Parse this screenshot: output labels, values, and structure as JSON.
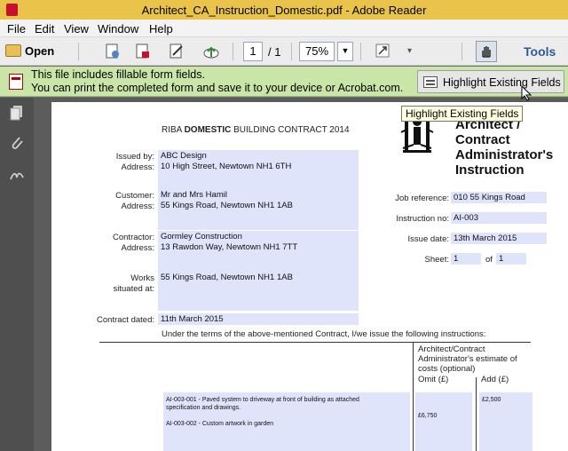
{
  "window": {
    "title": "Architect_CA_Instruction_Domestic.pdf - Adobe Reader"
  },
  "menu": [
    "File",
    "Edit",
    "View",
    "Window",
    "Help"
  ],
  "toolbar": {
    "open_label": "Open",
    "page_current": "1",
    "page_total": "/ 1",
    "zoom": "75%",
    "tools_label": "Tools"
  },
  "form_notice": {
    "line1": "This file includes fillable form fields.",
    "line2": "You can print the completed form and save it to your device or Acrobat.com.",
    "button": "Highlight Existing Fields",
    "tooltip": "Highlight Existing Fields"
  },
  "document": {
    "header_prefix": "RIBA ",
    "header_bold": "DOMESTIC",
    "header_suffix": " BUILDING CONTRACT 2014",
    "title_lines": [
      "Architect /",
      "Contract",
      "Administrator's",
      "Instruction"
    ],
    "labels": {
      "issued_by": "Issued by:",
      "issued_address": "Address:",
      "customer": "Customer:",
      "customer_address": "Address:",
      "contractor": "Contractor:",
      "contractor_address": "Address:",
      "works_1": "Works",
      "works_2": "situated at:",
      "contract_dated": "Contract dated:",
      "job_reference": "Job reference:",
      "instruction_no": "Instruction no:",
      "issue_date": "Issue date:",
      "sheet": "Sheet:",
      "of": "of"
    },
    "values": {
      "issued_by": "ABC Design",
      "issued_address": "10 High Street, Newtown NH1 6TH",
      "customer": "Mr and Mrs Hamil",
      "customer_address": "55 Kings Road, Newtown NH1 1AB",
      "contractor": "Gormley Construction",
      "contractor_address": "13 Rawdon Way, Newtown NH1 7TT",
      "works": "55 Kings Road, Newtown NH1 1AB",
      "contract_dated": "11th March 2015",
      "job_reference": "010 55 Kings Road",
      "instruction_no": "AI-003",
      "issue_date": "13th March 2015",
      "sheet": "1",
      "sheet_of": "1"
    },
    "instructions_intro": "Under the terms of the above-mentioned Contract, I/we issue the following instructions:",
    "estimate_header": [
      "Architect/Contract",
      "Administrator's estimate of",
      "costs (optional)"
    ],
    "omit_label": "Omit (£)",
    "add_label": "Add (£)",
    "instructions": [
      {
        "line1": "AI-003-001 - Paved system to driveway at front of building as attached",
        "line2": "specification and drawings.",
        "omit": "",
        "add": "£2,500"
      },
      {
        "line1": "AI-003-002 - Custom artwork in garden",
        "line2": "",
        "omit": "£6,750",
        "add": ""
      }
    ]
  }
}
